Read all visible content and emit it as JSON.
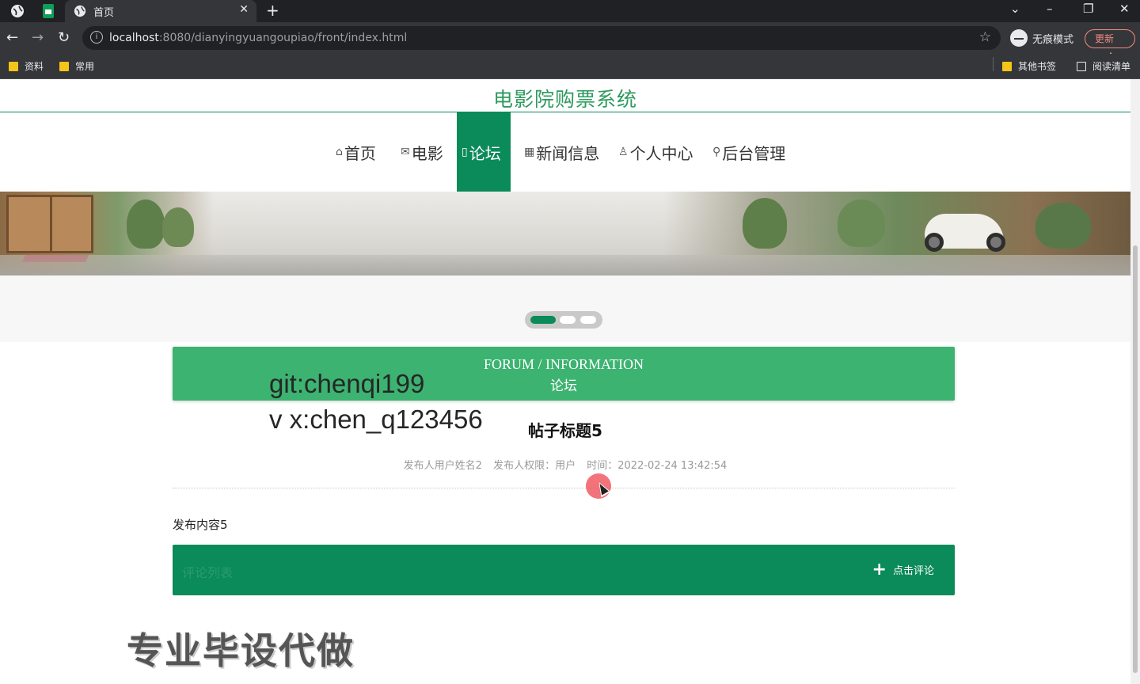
{
  "browser": {
    "tab_title": "首页",
    "url_host": "localhost",
    "url_rest": ":8080/dianyingyuangoupiao/front/index.html",
    "incognito_label": "无痕模式",
    "update_label": "更新",
    "bookmarks": [
      "资料",
      "常用"
    ],
    "other_bookmarks": "其他书签",
    "reading_list": "阅读清单"
  },
  "site": {
    "title": "电影院购票系统",
    "nav": [
      {
        "label": "首页",
        "icon": "home-icon",
        "glyph": "⌂"
      },
      {
        "label": "电影",
        "icon": "mail-icon",
        "glyph": "✉"
      },
      {
        "label": "论坛",
        "icon": "document-icon",
        "glyph": "▯"
      },
      {
        "label": "新闻信息",
        "icon": "calendar-icon",
        "glyph": "▦"
      },
      {
        "label": "个人中心",
        "icon": "user-icon",
        "glyph": "♙"
      },
      {
        "label": "后台管理",
        "icon": "link-icon",
        "glyph": "⚲"
      }
    ],
    "active_nav_index": 2,
    "accent_color": "#0b8a5a"
  },
  "forum_header": {
    "en": "FORUM / INFORMATION",
    "cn": "论坛"
  },
  "watermark": {
    "line1": "git:chenqi199",
    "line2": "v x:chen_q123456",
    "bottom": "专业毕设代做"
  },
  "post": {
    "title": "帖子标题5",
    "author": "发布人用户姓名2",
    "role": "发布人权限：用户",
    "time": "时间：2022-02-24 13:42:54",
    "content": "发布内容5"
  },
  "comment": {
    "heading": "评论列表",
    "button": "点击评论"
  }
}
